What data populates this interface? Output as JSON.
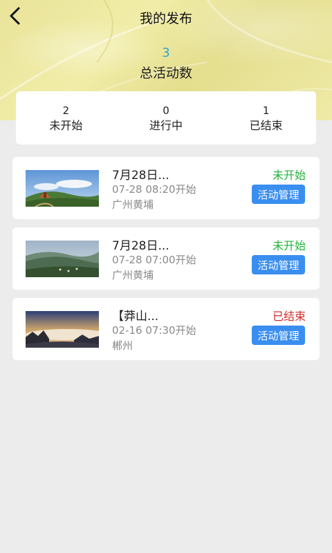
{
  "header": {
    "title": "我的发布",
    "back_icon": "chevron-left-icon"
  },
  "summary": {
    "total": "3",
    "total_label": "总活动数",
    "total_color": "#2fa6d0"
  },
  "stats": [
    {
      "count": "2",
      "label": "未开始"
    },
    {
      "count": "0",
      "label": "进行中"
    },
    {
      "count": "1",
      "label": "已结束"
    }
  ],
  "activities": [
    {
      "title": "7月28日...",
      "time": "07-28 08:20开始",
      "place": "广州黄埔",
      "status": "未开始",
      "status_color": "#1fb33a",
      "button": "活动管理"
    },
    {
      "title": "7月28日...",
      "time": "07-28 07:00开始",
      "place": "广州黄埔",
      "status": "未开始",
      "status_color": "#1fb33a",
      "button": "活动管理"
    },
    {
      "title": "【莽山...",
      "time": "02-16 07:30开始",
      "place": "郴州",
      "status": "已结束",
      "status_color": "#d42a2a",
      "button": "活动管理"
    }
  ],
  "colors": {
    "accent_button": "#3a8ef0",
    "background": "#ececec"
  }
}
